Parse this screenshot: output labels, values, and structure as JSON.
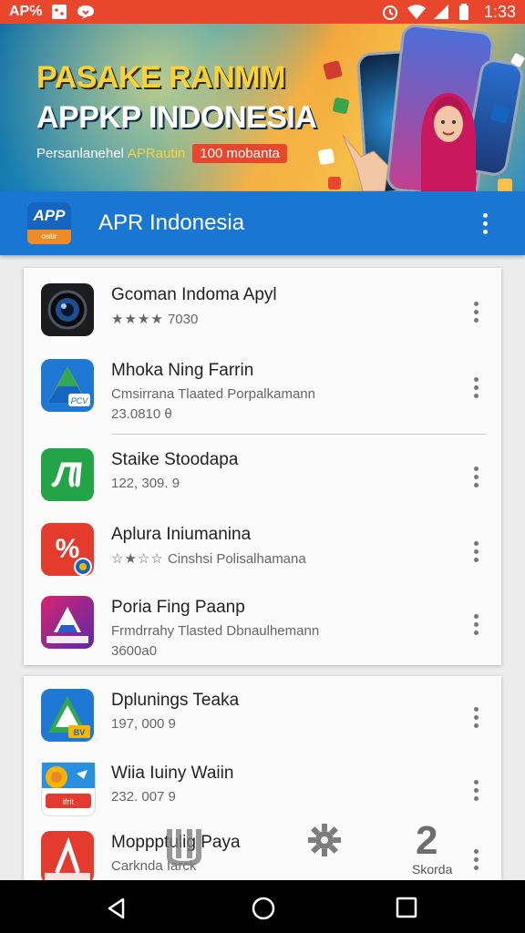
{
  "status_bar": {
    "left_label": "AP℅",
    "time": "1:33"
  },
  "banner": {
    "title_line1": "PASAKE RANMM",
    "title_line2": "APPKP INDONESIA",
    "subtitle": "Persanlanehel",
    "subtitle_highlight": "APRautin",
    "pill": "100 mobanta"
  },
  "app_bar": {
    "logo_text": "APP",
    "logo_subtext": "ositir",
    "title": "APR Indonesia"
  },
  "card1": {
    "items": [
      {
        "name": "Gcoman Indoma Apyl",
        "line1": "7030",
        "line2": "",
        "rating_stars": "★★★★"
      },
      {
        "name": "Mhoka Ning Farrin",
        "line1": "Cmsirrana Tlaated Porpalkamann",
        "line2": "23.0810 θ"
      },
      {
        "name": "Staike Stoodapa",
        "line1": "122, 309. 9",
        "line2": ""
      },
      {
        "name": "Aplura Iniumanina",
        "line1": "Cinshsi Polisalhamana",
        "line2": "",
        "rating_stars": "☆★☆☆"
      },
      {
        "name": "Poria Fing Paanp",
        "line1": "Frmdrrahy Tlasted Dbnaulhemann",
        "line2": "3600a0"
      }
    ]
  },
  "card2": {
    "items": [
      {
        "name": "Dplunings Teaka",
        "line1": "197, 000 9",
        "line2": ""
      },
      {
        "name": "Wiia Iuiny Waiin",
        "line1": "232. 007 9",
        "line2": ""
      },
      {
        "name": "Moppptulig Paya",
        "line1": "Carknda Iarck",
        "line2": ""
      }
    ]
  },
  "overlay": {
    "badge_number": "2",
    "badge_label": "Skorda"
  },
  "colors": {
    "status_bar": "#e8472d",
    "app_bar": "#1976d2",
    "accent_orange": "#f08a24"
  }
}
